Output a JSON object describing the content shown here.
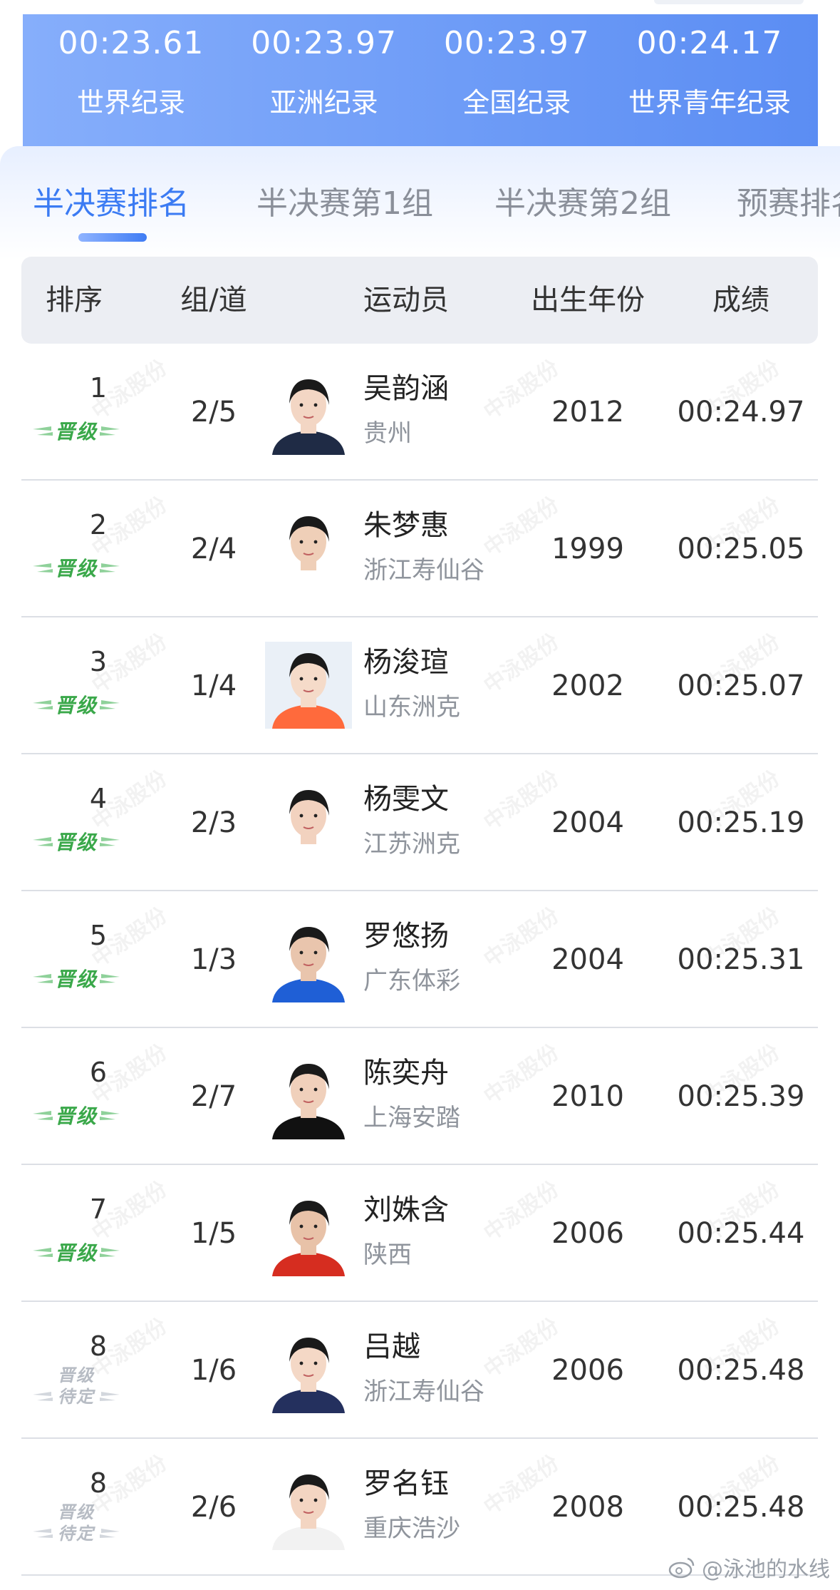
{
  "records": [
    {
      "time": "00:23.61",
      "label": "世界纪录"
    },
    {
      "time": "00:23.97",
      "label": "亚洲纪录"
    },
    {
      "time": "00:23.97",
      "label": "全国纪录"
    },
    {
      "time": "00:24.17",
      "label": "世界青年纪录"
    }
  ],
  "tabs": [
    {
      "label": "半决赛排名",
      "active": true
    },
    {
      "label": "半决赛第1组",
      "active": false
    },
    {
      "label": "半决赛第2组",
      "active": false
    },
    {
      "label": "预赛排名",
      "active": false
    }
  ],
  "table": {
    "headers": [
      "排序",
      "组/道",
      "运动员",
      "出生年份",
      "成绩"
    ],
    "rows": [
      {
        "rank": "1",
        "status": "晋级",
        "lane": "2/5",
        "name": "吴韵涵",
        "team": "贵州",
        "year": "2012",
        "result": "00:24.97"
      },
      {
        "rank": "2",
        "status": "晋级",
        "lane": "2/4",
        "name": "朱梦惠",
        "team": "浙江寿仙谷",
        "year": "1999",
        "result": "00:25.05"
      },
      {
        "rank": "3",
        "status": "晋级",
        "lane": "1/4",
        "name": "杨浚瑄",
        "team": "山东洲克",
        "year": "2002",
        "result": "00:25.07"
      },
      {
        "rank": "4",
        "status": "晋级",
        "lane": "2/3",
        "name": "杨雯文",
        "team": "江苏洲克",
        "year": "2004",
        "result": "00:25.19"
      },
      {
        "rank": "5",
        "status": "晋级",
        "lane": "1/3",
        "name": "罗悠扬",
        "team": "广东体彩",
        "year": "2004",
        "result": "00:25.31"
      },
      {
        "rank": "6",
        "status": "晋级",
        "lane": "2/7",
        "name": "陈奕舟",
        "team": "上海安踏",
        "year": "2010",
        "result": "00:25.39"
      },
      {
        "rank": "7",
        "status": "晋级",
        "lane": "1/5",
        "name": "刘姝含",
        "team": "陕西",
        "year": "2006",
        "result": "00:25.44"
      },
      {
        "rank": "8",
        "status": "晋级\n待定",
        "lane": "1/6",
        "name": "吕越",
        "team": "浙江寿仙谷",
        "year": "2006",
        "result": "00:25.48"
      },
      {
        "rank": "8",
        "status": "晋级\n待定",
        "lane": "2/6",
        "name": "罗名钰",
        "team": "重庆浩沙",
        "year": "2008",
        "result": "00:25.48"
      }
    ]
  },
  "watermark": {
    "text": "中泳股份",
    "footer": "@泳池的水线"
  },
  "colors": {
    "accent": "#3b7bf3",
    "qualified": "#3aa84a",
    "pending": "#b7bcc4"
  }
}
